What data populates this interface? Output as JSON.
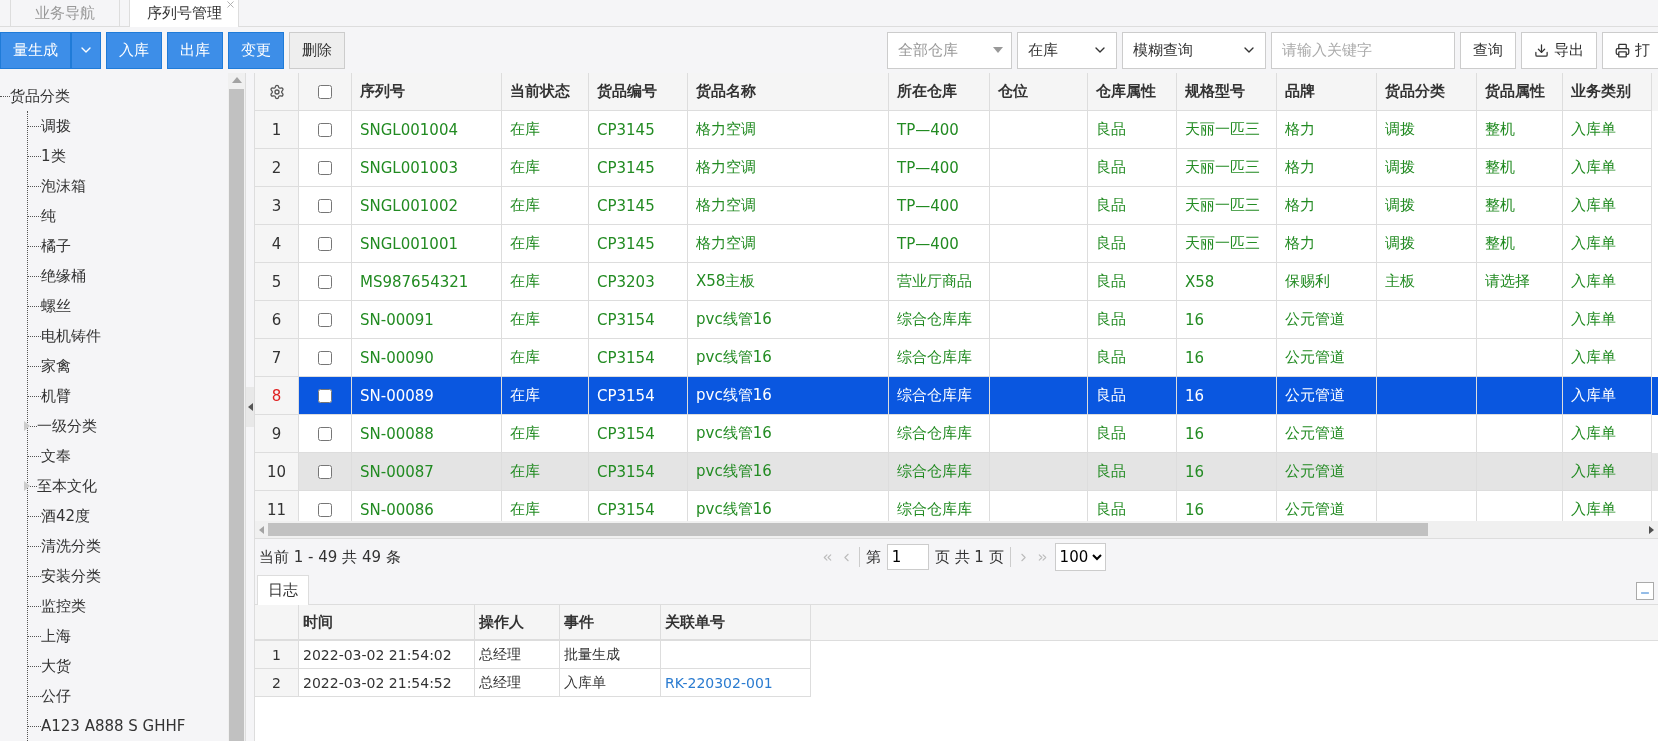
{
  "tabs": [
    {
      "label": "业务导航",
      "selected": false
    },
    {
      "label": "序列号管理",
      "selected": true,
      "closable": true
    }
  ],
  "toolbar": {
    "split_button": "量生成",
    "buttons": [
      "入库",
      "出库",
      "变更"
    ],
    "delete_button": "删除",
    "warehouse_select": {
      "placeholder": "全部仓库"
    },
    "status_select": "在库",
    "mode_select": "模糊查询",
    "search": {
      "placeholder": "请输入关键字"
    },
    "query_button": "查询",
    "export_button": "导出",
    "print_button": "打"
  },
  "tree": {
    "label": "货品分类",
    "children": [
      {
        "label": "调拨",
        "has_children": false
      },
      {
        "label": "1类",
        "has_children": false
      },
      {
        "label": "泡沫箱",
        "has_children": false
      },
      {
        "label": "纯",
        "has_children": false
      },
      {
        "label": "橘子",
        "has_children": false
      },
      {
        "label": "绝缘桶",
        "has_children": false
      },
      {
        "label": "螺丝",
        "has_children": false
      },
      {
        "label": "电机铸件",
        "has_children": false
      },
      {
        "label": "家禽",
        "has_children": false
      },
      {
        "label": "机臂",
        "has_children": false
      },
      {
        "label": "一级分类",
        "has_children": true
      },
      {
        "label": "文奉",
        "has_children": false
      },
      {
        "label": "至本文化",
        "has_children": true
      },
      {
        "label": "酒42度",
        "has_children": false
      },
      {
        "label": "清洗分类",
        "has_children": false
      },
      {
        "label": "安装分类",
        "has_children": false
      },
      {
        "label": "监控类",
        "has_children": false
      },
      {
        "label": "上海",
        "has_children": false
      },
      {
        "label": "大货",
        "has_children": false
      },
      {
        "label": "公仔",
        "has_children": false
      },
      {
        "label": "A123 A888 S GHHF",
        "has_children": false
      }
    ]
  },
  "grid": {
    "select_all_checked": false,
    "columns": [
      "序列号",
      "当前状态",
      "货品编号",
      "货品名称",
      "所在仓库",
      "仓位",
      "仓库属性",
      "规格型号",
      "品牌",
      "货品分类",
      "货品属性",
      "业务类别"
    ],
    "rows": [
      {
        "num": "1",
        "checked": false,
        "selected": false,
        "hovered": false,
        "cells": [
          "SNGL001004",
          "在库",
          "CP3145",
          "格力空调",
          "TP—400",
          null,
          "良品",
          "天丽一匹三",
          "格力",
          "调拨",
          "整机",
          "入库单"
        ]
      },
      {
        "num": "2",
        "checked": false,
        "selected": false,
        "hovered": false,
        "cells": [
          "SNGL001003",
          "在库",
          "CP3145",
          "格力空调",
          "TP—400",
          null,
          "良品",
          "天丽一匹三",
          "格力",
          "调拨",
          "整机",
          "入库单"
        ]
      },
      {
        "num": "3",
        "checked": false,
        "selected": false,
        "hovered": false,
        "cells": [
          "SNGL001002",
          "在库",
          "CP3145",
          "格力空调",
          "TP—400",
          null,
          "良品",
          "天丽一匹三",
          "格力",
          "调拨",
          "整机",
          "入库单"
        ]
      },
      {
        "num": "4",
        "checked": false,
        "selected": false,
        "hovered": false,
        "cells": [
          "SNGL001001",
          "在库",
          "CP3145",
          "格力空调",
          "TP—400",
          null,
          "良品",
          "天丽一匹三",
          "格力",
          "调拨",
          "整机",
          "入库单"
        ]
      },
      {
        "num": "5",
        "checked": false,
        "selected": false,
        "hovered": false,
        "cells": [
          "MS987654321",
          "在库",
          "CP3203",
          "X58主板",
          "营业厅商品",
          null,
          "良品",
          "X58",
          "保赐利",
          "主板",
          "请选择",
          "入库单"
        ]
      },
      {
        "num": "6",
        "checked": false,
        "selected": false,
        "hovered": false,
        "cells": [
          "SN-00091",
          "在库",
          "CP3154",
          "pvc线管16",
          "综合仓库库",
          null,
          "良品",
          "16",
          "公元管道",
          null,
          null,
          "入库单"
        ]
      },
      {
        "num": "7",
        "checked": false,
        "selected": false,
        "hovered": false,
        "cells": [
          "SN-00090",
          "在库",
          "CP3154",
          "pvc线管16",
          "综合仓库库",
          null,
          "良品",
          "16",
          "公元管道",
          null,
          null,
          "入库单"
        ]
      },
      {
        "num": "8",
        "checked": false,
        "selected": true,
        "hovered": false,
        "cells": [
          "SN-00089",
          "在库",
          "CP3154",
          "pvc线管16",
          "综合仓库库",
          null,
          "良品",
          "16",
          "公元管道",
          null,
          null,
          "入库单"
        ]
      },
      {
        "num": "9",
        "checked": false,
        "selected": false,
        "hovered": false,
        "cells": [
          "SN-00088",
          "在库",
          "CP3154",
          "pvc线管16",
          "综合仓库库",
          null,
          "良品",
          "16",
          "公元管道",
          null,
          null,
          "入库单"
        ]
      },
      {
        "num": "10",
        "checked": false,
        "selected": false,
        "hovered": true,
        "cells": [
          "SN-00087",
          "在库",
          "CP3154",
          "pvc线管16",
          "综合仓库库",
          null,
          "良品",
          "16",
          "公元管道",
          null,
          null,
          "入库单"
        ]
      },
      {
        "num": "11",
        "checked": false,
        "selected": false,
        "hovered": false,
        "cells": [
          "SN-00086",
          "在库",
          "CP3154",
          "pvc线管16",
          "综合仓库库",
          null,
          "良品",
          "16",
          "公元管道",
          null,
          null,
          "入库单"
        ]
      }
    ]
  },
  "pager": {
    "summary": "当前 1 - 49 共 49 条",
    "page_prefix": "第",
    "page": "1",
    "page_suffix": "页 共 1 页",
    "page_size": "100"
  },
  "log": {
    "tab": "日志",
    "columns": [
      "时间",
      "操作人",
      "事件",
      "关联单号"
    ],
    "rows": [
      {
        "num": "1",
        "time": "2022-03-02 21:54:02",
        "operator": "总经理",
        "event": "批量生成"
      },
      {
        "num": "2",
        "time": "2022-03-02 21:54:52",
        "operator": "总经理",
        "event": "入库单",
        "ref": "RK-220302-001"
      }
    ]
  }
}
